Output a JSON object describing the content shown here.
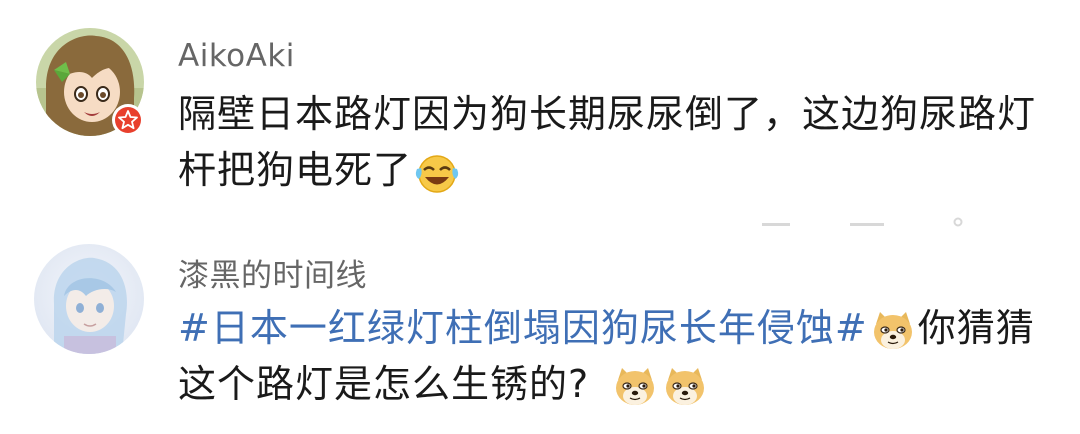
{
  "comments": [
    {
      "username": "AikoAki",
      "text_line1": "隔壁日本路灯因为狗长期尿尿倒了，这边狗尿路灯",
      "text_line2": "杆把狗电死了",
      "emoji": "laughing-crying-emoji",
      "badge_icon": "star-badge-icon"
    },
    {
      "username": "漆黑的时间线",
      "topic": "#日本一红绿灯柱倒塌因狗尿长年侵蚀#",
      "text_after_topic": "你猜猜",
      "text_line2": "这个路灯是怎么生锈的?",
      "emoji": "doge-emoji"
    }
  ],
  "colors": {
    "username": "#666666",
    "text": "#1a1a1a",
    "topic_link": "#3f6fb5",
    "badge": "#e8402d"
  }
}
